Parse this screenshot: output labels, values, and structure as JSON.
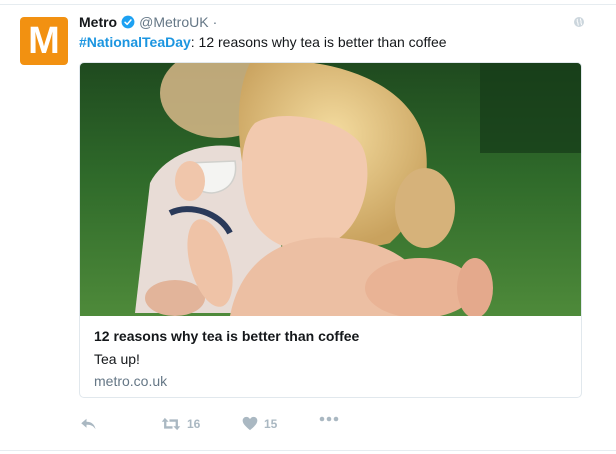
{
  "tweet": {
    "author_name": "Metro",
    "author_handle": "@MetroUK",
    "separator": "·",
    "avatar_letter": "M",
    "hashtag": "#NationalTeaDay",
    "text": ": 12 reasons why tea is better than coffee",
    "card": {
      "title": "12 reasons why tea is better than coffee",
      "description": "Tea up!",
      "domain": "metro.co.uk"
    },
    "actions": {
      "retweet_count": "16",
      "like_count": "15"
    }
  },
  "colors": {
    "avatar_bg": "#f29111",
    "hashtag": "#1b95e0",
    "verified": "#1da1f2",
    "muted": "#657786",
    "action": "#aab8c2"
  },
  "icons": [
    "globe-icon",
    "verified-badge-icon",
    "reply-icon",
    "retweet-icon",
    "heart-icon",
    "more-icon"
  ]
}
